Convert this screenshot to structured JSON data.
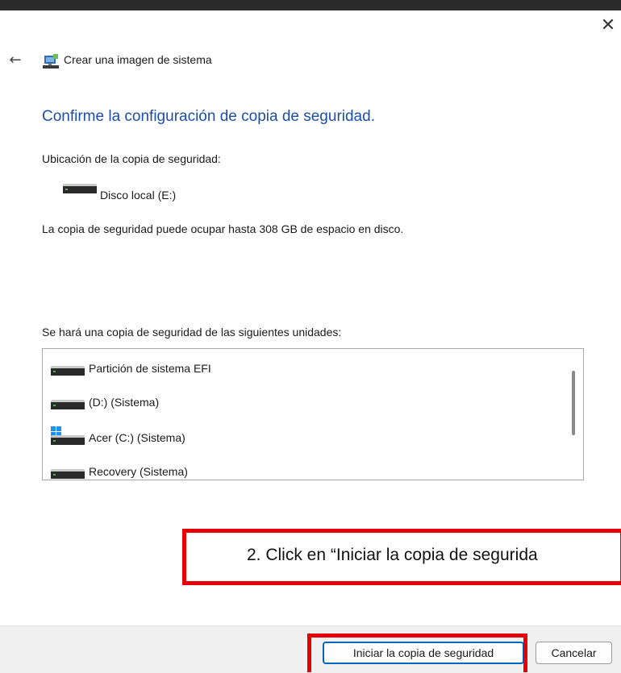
{
  "window": {
    "close_glyph": "✕",
    "back_glyph": "←"
  },
  "header": {
    "title": "Crear una imagen de sistema",
    "icon": "system-image-icon"
  },
  "main": {
    "heading": "Confirme la configuración de copia de seguridad.",
    "location_label": "Ubicación de la copia de seguridad:",
    "location_drive": "Disco local (E:)",
    "space_note": "La copia de seguridad puede ocupar hasta 308 GB de espacio en disco.",
    "drives_label": "Se hará una copia de seguridad de las siguientes unidades:",
    "drives": [
      {
        "label": "Partición de sistema EFI",
        "icon": "drive-icon"
      },
      {
        "label": "(D:) (Sistema)",
        "icon": "drive-icon"
      },
      {
        "label": "Acer (C:) (Sistema)",
        "icon": "windows-drive-icon"
      },
      {
        "label": "Recovery (Sistema)",
        "icon": "drive-icon"
      }
    ]
  },
  "annotation": {
    "text": "2.   Click en “Iniciar la copia de segurida",
    "color": "#e60000"
  },
  "footer": {
    "start_button": "Iniciar la copia de seguridad",
    "cancel_button": "Cancelar"
  },
  "colors": {
    "heading": "#1e4fa6",
    "accent": "#0067c0",
    "highlight": "#e60000"
  }
}
